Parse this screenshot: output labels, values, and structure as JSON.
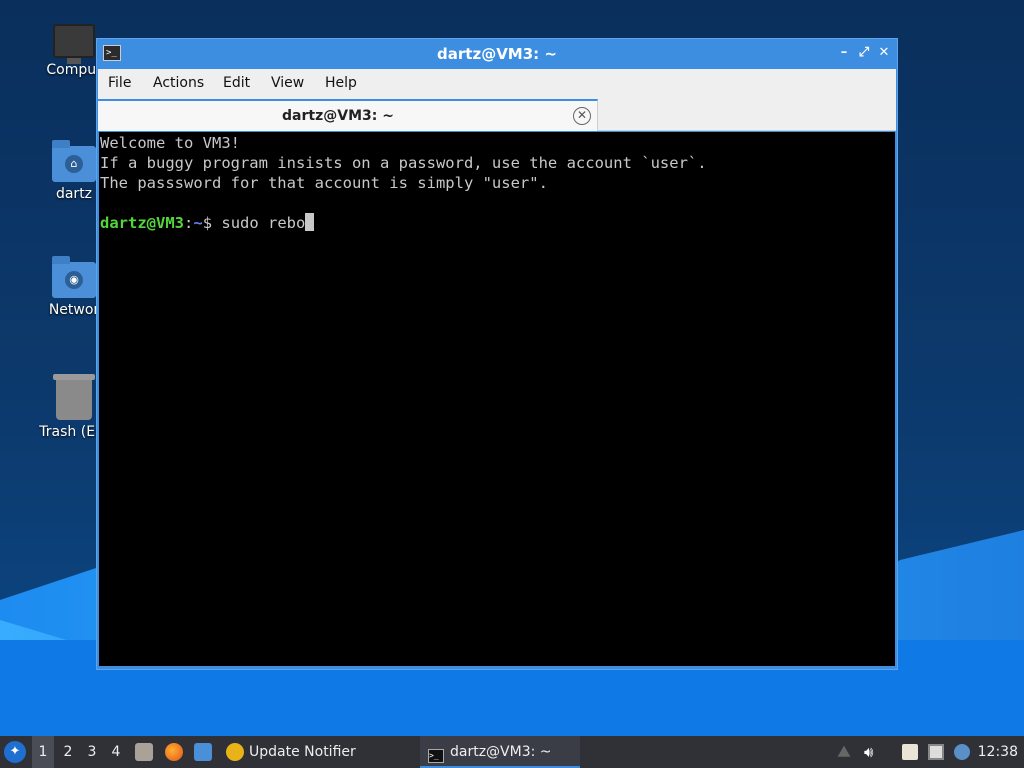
{
  "desktop": {
    "icons": [
      {
        "label": "Comput"
      },
      {
        "label": "dartz"
      },
      {
        "label": "Networ"
      },
      {
        "label": "Trash (Em"
      }
    ]
  },
  "window": {
    "title": "dartz@VM3: ~",
    "title_icon": ">_",
    "controls": {
      "minimize": "–",
      "maximize": "⤢",
      "close": "✕"
    },
    "menu": [
      "File",
      "Actions",
      "Edit",
      "View",
      "Help"
    ],
    "tab": {
      "label": "dartz@VM3: ~",
      "close": "✕"
    }
  },
  "terminal": {
    "lines": [
      "Welcome to VM3!",
      "If a buggy program insists on a password, use the account `user`.",
      "The passsword for that account is simply \"user\"."
    ],
    "prompt_user": "dartz@VM3",
    "prompt_sep": ":",
    "prompt_path": "~",
    "prompt_symbol": "$ ",
    "command": "sudo rebo"
  },
  "taskbar": {
    "workspaces": [
      "1",
      "2",
      "3",
      "4"
    ],
    "active_workspace": "1",
    "update_notifier": "Update Notifier",
    "active_task": "dartz@VM3: ~",
    "clock": "12:38"
  },
  "colors": {
    "accent": "#3d8ee0",
    "prompt_user": "#52d63a",
    "prompt_path": "#6a7ff0",
    "terminal_bg": "#000000",
    "taskbar_bg": "#2f3137"
  }
}
